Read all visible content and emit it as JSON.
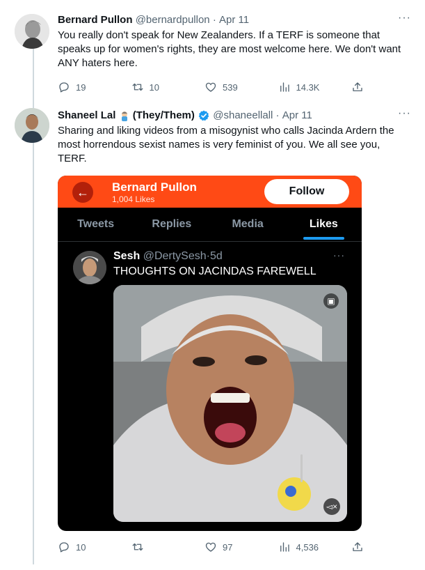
{
  "tweets": [
    {
      "name": "Bernard Pullon",
      "handle": "@bernardpullon",
      "dot": "·",
      "time": "Apr 11",
      "more": "···",
      "lines": [
        "You really don't speak for New Zealanders. If a TERF is someone that",
        "speaks up for women's rights, they are most welcome here. We don't want",
        "ANY haters here."
      ],
      "stats": {
        "replies": "19",
        "retweets": "10",
        "likes": "539",
        "views": "14.3K"
      }
    },
    {
      "name": "Shaneel Lal",
      "name_suffix": "(They/Them)",
      "handle": "@shaneellall",
      "dot": "·",
      "time": "Apr 11",
      "more": "···",
      "lines": [
        "Sharing and liking videos from a misogynist who calls Jacinda Ardern the",
        "most horrendous sexist names is very feminist of you. We all see you,",
        "TERF."
      ],
      "stats": {
        "replies": "10",
        "retweets": "",
        "likes": "97",
        "views": "4,536"
      }
    }
  ],
  "embedded": {
    "profile_name": "Bernard Pullon",
    "profile_likes": "1,004 Likes",
    "follow_label": "Follow",
    "tabs": [
      "Tweets",
      "Replies",
      "Media",
      "Likes"
    ],
    "active_tab": "Likes",
    "quoted": {
      "name": "Sesh",
      "handle": "@DertySesh",
      "dot": "·",
      "time": "5d",
      "text": "THOUGHTS ON JACINDAS FAREWELL",
      "more": "···"
    }
  },
  "colors": {
    "accent": "#1d9bf0",
    "embedded_header": "#ff4a15",
    "muted_text": "#536471",
    "verified": "#1d9bf0"
  },
  "icons": {
    "reply": "reply-icon",
    "retweet": "retweet-icon",
    "like": "heart-icon",
    "views": "views-icon",
    "share": "share-icon",
    "verified": "verified-badge-icon",
    "emoji": "person-emoji-icon"
  }
}
